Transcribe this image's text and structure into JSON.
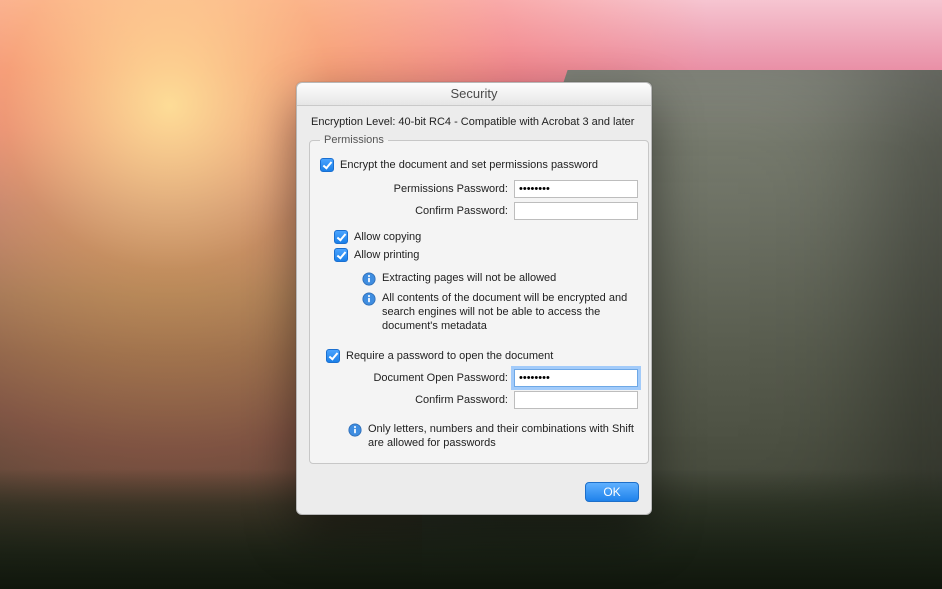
{
  "dialog": {
    "title": "Security",
    "encryption_level": "Encryption Level: 40-bit RC4 - Compatible with Acrobat 3 and later",
    "permissions_legend": "Permissions",
    "encrypt_set_permissions": {
      "label": "Encrypt the document and set permissions password",
      "checked": true
    },
    "permissions_password_label": "Permissions Password:",
    "permissions_password_value": "••••••••",
    "confirm_password_label": "Confirm Password:",
    "confirm_password_value": "",
    "allow_copying": {
      "label": "Allow copying",
      "checked": true
    },
    "allow_printing": {
      "label": "Allow printing",
      "checked": true
    },
    "info_extracting": "Extracting pages will not be allowed",
    "info_contents": "All contents of the document will be encrypted and search engines will not be able to access the document's metadata",
    "require_open_password": {
      "label": "Require a password to open the document",
      "checked": true
    },
    "doc_open_password_label": "Document Open Password:",
    "doc_open_password_value": "••••••••",
    "confirm_open_password_label": "Confirm Password:",
    "confirm_open_password_value": "",
    "info_chars": "Only letters, numbers and their combinations with Shift are allowed for passwords",
    "ok_label": "OK"
  }
}
